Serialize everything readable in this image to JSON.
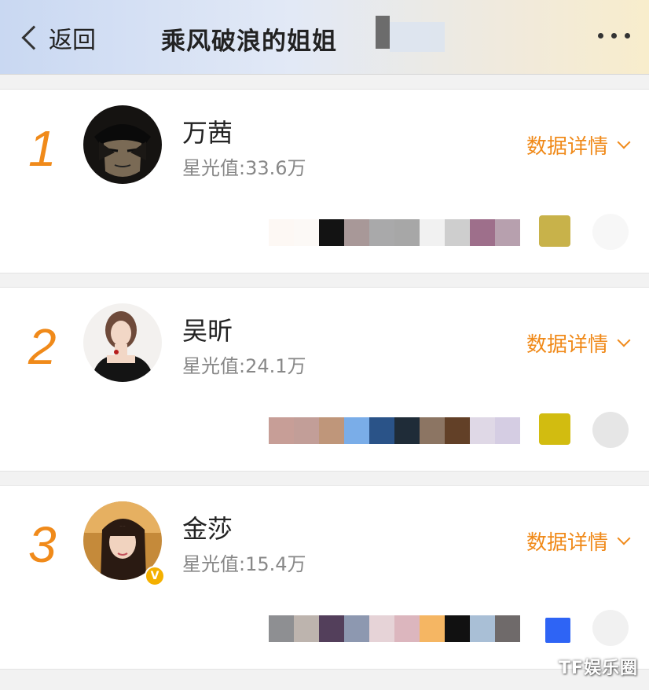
{
  "header": {
    "back_label": "返回",
    "title": "乘风破浪的姐姐",
    "more_icon": "more-dots-icon"
  },
  "list": [
    {
      "rank": "1",
      "name": "万茜",
      "star_value": "星光值:33.6万",
      "details_label": "数据详情",
      "swatches": [
        "#fdf8f4",
        "#fcf9f6",
        "#131313",
        "#a89898",
        "#a9a9aa",
        "#a7a7a7",
        "#f1f1f1",
        "#cecece",
        "#9e6f8b",
        "#b7a0ae"
      ],
      "end_colors": [
        "#c8b24a",
        "#f7f7f7"
      ]
    },
    {
      "rank": "2",
      "name": "吴昕",
      "star_value": "星光值:24.1万",
      "details_label": "数据详情",
      "swatches": [
        "#c79e97",
        "#c29e98",
        "#bf967a",
        "#7aade8",
        "#2a5388",
        "#1f2c38",
        "#8c7563",
        "#624027",
        "#dfd8e6",
        "#d5cde3"
      ],
      "end_colors": [
        "#d2bc10",
        "#e6e6e6"
      ]
    },
    {
      "rank": "3",
      "name": "金莎",
      "star_value": "星光值:15.4万",
      "details_label": "数据详情",
      "swatches": [
        "#8e8f92",
        "#bdb4ae",
        "#533f5b",
        "#8d98b0",
        "#e6d3d7",
        "#dcb6be",
        "#f5b663",
        "#111111",
        "#a9bfd6",
        "#6f6a6a"
      ],
      "end_colors": [
        "#2e64f5",
        "#f1f1f1"
      ]
    }
  ],
  "watermark": "TF娱乐圈"
}
